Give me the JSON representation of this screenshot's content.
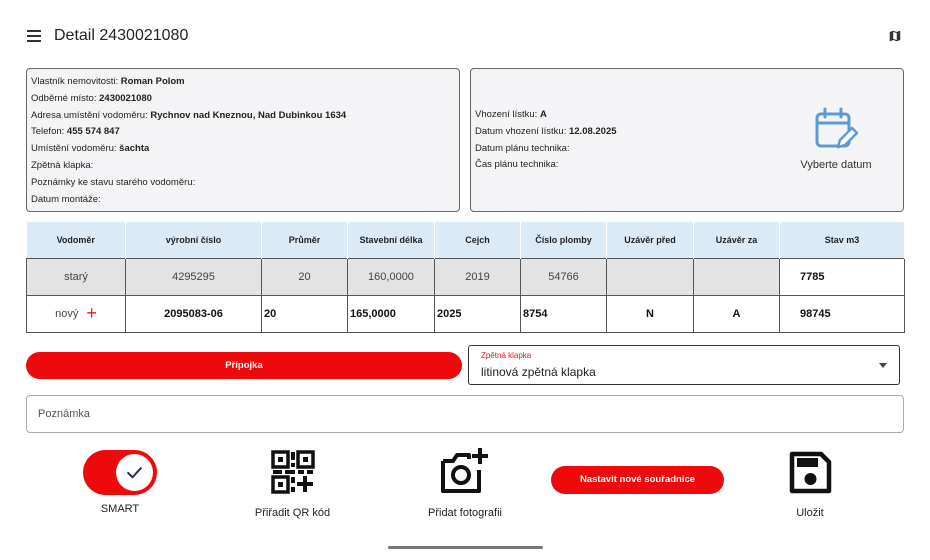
{
  "header": {
    "title": "Detail 2430021080"
  },
  "owner_panel": {
    "lines": [
      {
        "label": "Vlastník nemovitosti: ",
        "value": "Roman Polom"
      },
      {
        "label": "Odběrné místo: ",
        "value": "2430021080"
      },
      {
        "label": "Adresa umístění vodoměru: ",
        "value": "Rychnov nad Kneznou, Nad Dubinkou 1634"
      },
      {
        "label": "Telefon: ",
        "value": "455 574 847"
      },
      {
        "label": "Umístění vodoměru: ",
        "value": "šachta"
      },
      {
        "label": "Zpětná klapka:",
        "value": ""
      },
      {
        "label": "Poznámky ke stavu starého vodoměru:",
        "value": ""
      },
      {
        "label": "Datum montáže:",
        "value": ""
      }
    ]
  },
  "ticket_panel": {
    "lines": [
      {
        "label": "Vhození lístku: ",
        "value": "A"
      },
      {
        "label": "Datum vhození lístku: ",
        "value": "12.08.2025"
      },
      {
        "label": "Datum plánu technika:",
        "value": ""
      },
      {
        "label": "Čas plánu technika:",
        "value": ""
      }
    ],
    "date_picker_label": "Vyberte datum"
  },
  "meters_table": {
    "headers": [
      "Vodoměr",
      "výrobní číslo",
      "Průměr",
      "Stavební délka",
      "Cejch",
      "Číslo plomby",
      "Uzávěr před",
      "Uzávěr za",
      "Stav m3"
    ],
    "old_row": {
      "label": "starý",
      "serial": "4295295",
      "diameter": "20",
      "length": "160,0000",
      "calibration": "2019",
      "seal": "54766",
      "valve_before": "",
      "valve_after": "",
      "reading": "7785"
    },
    "new_row": {
      "label": "nový",
      "add_icon": "+",
      "serial": "2095083-06",
      "diameter": "20",
      "length": "165,0000",
      "calibration": "2025",
      "seal": "8754",
      "valve_before": "N",
      "valve_after": "A",
      "reading": "98745"
    }
  },
  "connection_button": "Přípojka",
  "check_valve_select": {
    "label": "Zpětná klapka",
    "value": "litinová zpětná klapka"
  },
  "note": {
    "placeholder": "Poznámka"
  },
  "actions": {
    "smart_label": "SMART",
    "smart_on": true,
    "qr_label": "Přiřadit QR kód",
    "photo_label": "Přidat fotografii",
    "coords_button": "Nastavit nové souřadnice",
    "save_label": "Uložit"
  },
  "colors": {
    "accent": "#ee0a0a",
    "table_header": "#dbeaf7",
    "panel_bg": "#f4f4f6",
    "calendar_icon": "#5b9bd5"
  },
  "icons": [
    "menu-icon",
    "map-icon",
    "calendar-edit-icon",
    "plus-icon",
    "check-icon",
    "qr-code-icon",
    "camera-plus-icon",
    "save-icon",
    "dropdown-caret-icon"
  ]
}
